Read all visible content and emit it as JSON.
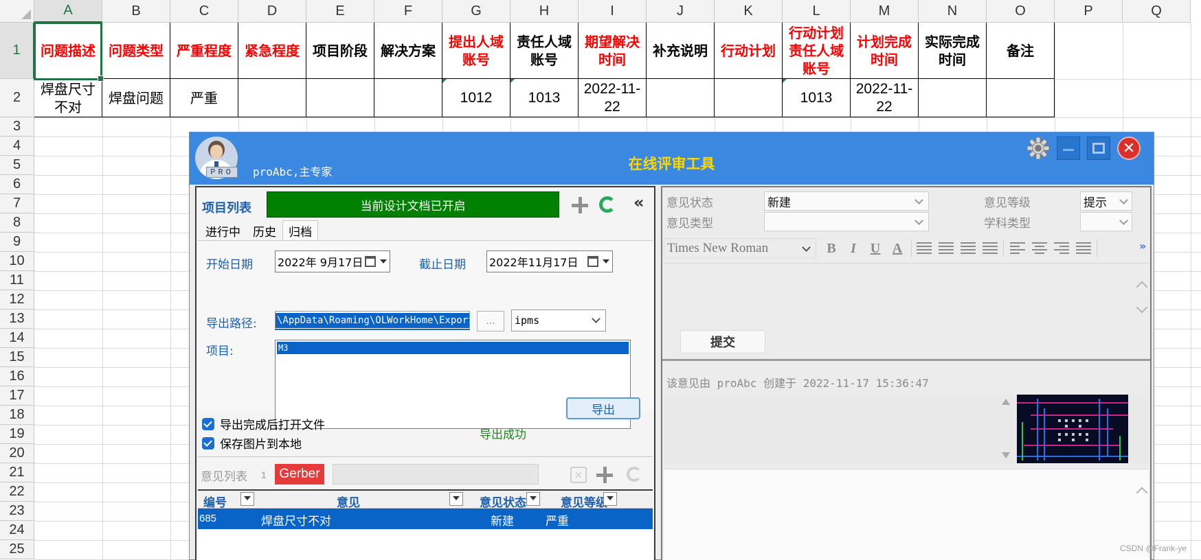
{
  "sheet": {
    "columns": [
      "A",
      "B",
      "C",
      "D",
      "E",
      "F",
      "G",
      "H",
      "I",
      "J",
      "K",
      "L",
      "M",
      "N",
      "O",
      "P",
      "Q"
    ],
    "rows": [
      "1",
      "2",
      "3",
      "4",
      "5",
      "6",
      "7",
      "8",
      "9",
      "10",
      "11",
      "12",
      "13",
      "14",
      "15",
      "16",
      "17",
      "18",
      "19",
      "20",
      "21",
      "22",
      "23",
      "24",
      "25"
    ],
    "header_cells": [
      {
        "text": "问题描述",
        "color": "red"
      },
      {
        "text": "问题类型",
        "color": "red"
      },
      {
        "text": "严重程度",
        "color": "red"
      },
      {
        "text": "紧急程度",
        "color": "red"
      },
      {
        "text": "项目阶段",
        "color": "black"
      },
      {
        "text": "解决方案",
        "color": "black"
      },
      {
        "text": "提出人域账号",
        "color": "red"
      },
      {
        "text": "责任人域账号",
        "color": "black"
      },
      {
        "text": "期望解决时间",
        "color": "red"
      },
      {
        "text": "补充说明",
        "color": "black"
      },
      {
        "text": "行动计划",
        "color": "red"
      },
      {
        "text": "行动计划责任人域账号",
        "color": "red"
      },
      {
        "text": "计划完成时间",
        "color": "red"
      },
      {
        "text": "实际完成时间",
        "color": "black"
      },
      {
        "text": "备注",
        "color": "black"
      }
    ],
    "data_row": [
      "焊盘尺寸不对",
      "焊盘问题",
      "严重",
      "",
      "",
      "",
      "1012",
      "1013",
      "2022-11-22",
      "",
      "",
      "1013",
      "2022-11-22",
      "",
      ""
    ],
    "selected_column": "A",
    "selected_row": "1"
  },
  "dialog": {
    "title": "在线评审工具",
    "pro_badge": "PRO",
    "user": "proAbc,主专家",
    "window_buttons": {
      "close": "✕"
    },
    "left": {
      "project_list_label": "项目列表",
      "doc_status": "当前设计文档已开启",
      "collapse": "«",
      "tabs": [
        "进行中",
        "历史",
        "归档"
      ],
      "active_tab": 2,
      "start_date_label": "开始日期",
      "start_date": "2022年 9月17日",
      "end_date_label": "截止日期",
      "end_date": "2022年11月17日",
      "export_path_label": "导出路径:",
      "export_path": "\\AppData\\Roaming\\OLWorkHome\\Export",
      "browse": "...",
      "format": "ipms",
      "project_label": "项目:",
      "projects": [
        "M3"
      ],
      "open_after_export": "导出完成后打开文件",
      "save_images": "保存图片到本地",
      "export_button": "导出",
      "export_status": "导出成功",
      "opinion_list_label": "意见列表",
      "opinion_count": "1",
      "gerber": "Gerber",
      "table_headers": [
        "编号",
        "意见",
        "意见状态",
        "意见等级"
      ],
      "rows": [
        {
          "id": "685",
          "opinion": "焊盘尺寸不对",
          "status": "新建",
          "level": "严重"
        }
      ]
    },
    "right": {
      "status_label": "意见状态",
      "status_value": "新建",
      "level_label": "意见等级",
      "level_value": "提示",
      "type_label": "意见类型",
      "type_value": "",
      "discipline_label": "学科类型",
      "discipline_value": "",
      "font": "Times New Roman",
      "toolbar": {
        "bold": "B",
        "italic": "I",
        "underline": "U",
        "font_color": "A",
        "more": "»"
      },
      "submit": "提交",
      "created_by": "该意见由 proAbc 创建于 2022-11-17 15:36:47"
    }
  },
  "watermark": "CSDN @Frank-ye",
  "colors": {
    "title_bar": "#3a88e0",
    "title_text": "#ffd700",
    "doc_status_bg": "#008000",
    "selection": "#0a64c8",
    "gerber": "#e53b3b",
    "excel_green": "#217346"
  }
}
